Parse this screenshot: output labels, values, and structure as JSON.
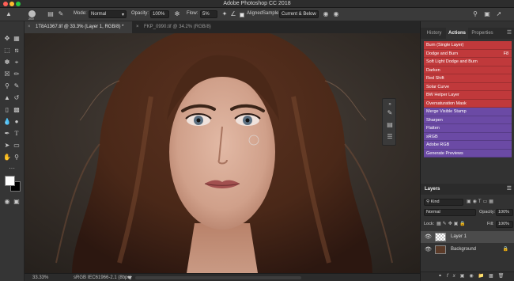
{
  "app": {
    "title": "Adobe Photoshop CC 2018"
  },
  "options_bar": {
    "brush_size": "200",
    "mode_label": "Mode:",
    "mode_value": "Normal",
    "opacity_label": "Opacity:",
    "opacity_value": "100%",
    "flow_label": "Flow:",
    "flow_value": "5%",
    "aligned_label": "Aligned",
    "sample_label": "Sample:",
    "sample_value": "Current & Below"
  },
  "tabs": [
    {
      "label": "1T8A1367.tif @ 33.3% (Layer 1, RGB/8) *"
    },
    {
      "label": "FKP_0990.tif @ 34.2% (RGB/8)"
    }
  ],
  "status": {
    "zoom": "33.33%",
    "profile": "sRGB IEC61966-2.1 (8bpc)"
  },
  "panels": {
    "tabs": [
      "History",
      "Actions",
      "Properties"
    ],
    "active_tab": "Actions",
    "actions": [
      {
        "label": "Burn (Single Layer)",
        "key": "",
        "color": "#c0393b"
      },
      {
        "label": "Dodge and Burn",
        "key": "F8",
        "color": "#c0393b"
      },
      {
        "label": "Soft Light Dodge and Burn",
        "key": "",
        "color": "#c0393b"
      },
      {
        "label": "Darken",
        "key": "",
        "color": "#c0393b"
      },
      {
        "label": "Red Shift",
        "key": "",
        "color": "#c0393b"
      },
      {
        "label": "Solar Curve",
        "key": "",
        "color": "#c0393b"
      },
      {
        "label": "BW Helper Layer",
        "key": "",
        "color": "#c0393b"
      },
      {
        "label": "Oversaturation Mask",
        "key": "",
        "color": "#c0393b"
      },
      {
        "label": "Merge Visible Stamp",
        "key": "",
        "color": "#6b4aa5"
      },
      {
        "label": "Sharpen",
        "key": "",
        "color": "#6b4aa5"
      },
      {
        "label": "Flatten",
        "key": "",
        "color": "#6b4aa5"
      },
      {
        "label": "sRGB",
        "key": "",
        "color": "#6b4aa5"
      },
      {
        "label": "Adobe RGB",
        "key": "",
        "color": "#6b4aa5"
      },
      {
        "label": "Generate Previews",
        "key": "",
        "color": "#6b4aa5"
      }
    ]
  },
  "layers": {
    "title": "Layers",
    "filter_value": "Kind",
    "blend_mode": "Normal",
    "opacity_label": "Opacity:",
    "opacity_value": "100%",
    "lock_label": "Lock:",
    "fill_label": "Fill:",
    "fill_value": "100%",
    "items": [
      {
        "name": "Layer 1"
      },
      {
        "name": "Background"
      }
    ]
  }
}
